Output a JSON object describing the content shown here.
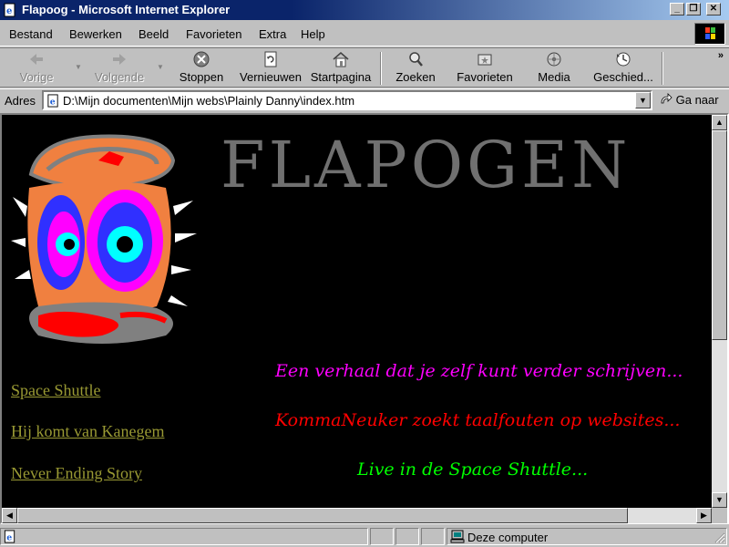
{
  "window": {
    "title": "Flapoog - Microsoft Internet Explorer",
    "minimize_glyph": "_",
    "restore_glyph": "❐",
    "close_glyph": "✕"
  },
  "menu": [
    "Bestand",
    "Bewerken",
    "Beeld",
    "Favorieten",
    "Extra",
    "Help"
  ],
  "toolbar": {
    "back": "Vorige",
    "forward": "Volgende",
    "stop": "Stoppen",
    "refresh": "Vernieuwen",
    "home": "Startpagina",
    "search": "Zoeken",
    "favorites": "Favorieten",
    "media": "Media",
    "history": "Geschied...",
    "chevron": "»"
  },
  "address": {
    "label": "Adres",
    "value": "D:\\Mijn documenten\\Mijn webs\\Plainly Danny\\index.htm",
    "go_label": "Ga naar"
  },
  "page": {
    "heading": "FLAPOGEN",
    "links": [
      "Space Shuttle",
      "Hij komt van Kanegem",
      "Never Ending Story"
    ],
    "lines": [
      {
        "text": "Een verhaal dat je zelf kunt verder schrijven...",
        "color": "#ff00ff"
      },
      {
        "text": "KommaNeuker zoekt taalfouten op websites...",
        "color": "#ff0000"
      },
      {
        "text": "Live in de Space Shuttle...",
        "color": "#00ff00"
      }
    ],
    "link_color": "#999933",
    "heading_color": "#707070",
    "background": "#000000"
  },
  "status": {
    "zone": "Deze computer"
  },
  "icons": {
    "app": "ie-page-icon",
    "back": "back-arrow-icon",
    "forward": "forward-arrow-icon",
    "stop": "stop-icon",
    "refresh": "refresh-icon",
    "home": "home-icon",
    "search": "search-icon",
    "favorites": "favorites-icon",
    "media": "media-icon",
    "history": "history-icon",
    "zone": "computer-icon"
  }
}
